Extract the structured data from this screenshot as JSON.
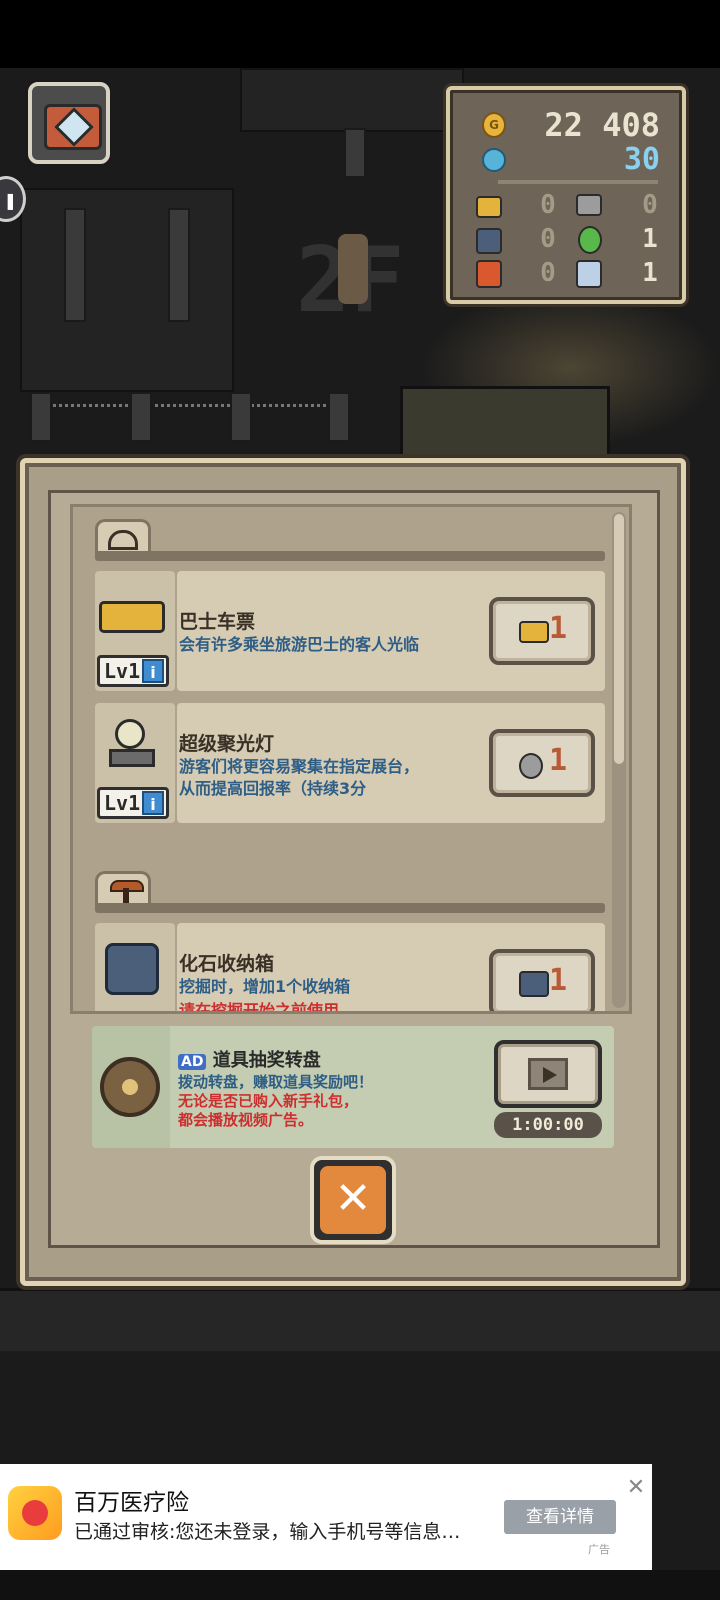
{
  "scene": {
    "floor_label": "2F"
  },
  "resources": {
    "coins": "22 408",
    "gems": "30",
    "inventory": [
      {
        "icon": "bus-ticket-icon",
        "count": "0",
        "color": "#e3b33c"
      },
      {
        "icon": "spotlight-icon",
        "count": "0",
        "color": "#9c9c9c"
      },
      {
        "icon": "storage-box-icon",
        "count": "0",
        "color": "#4c5f7a"
      },
      {
        "icon": "green-potion-icon",
        "count": "1",
        "color": "#58b84a"
      },
      {
        "icon": "red-canister-icon",
        "count": "0",
        "color": "#d9582e"
      },
      {
        "icon": "robot-icon",
        "count": "1",
        "color": "#bcd1e6"
      }
    ]
  },
  "shop": {
    "categories": [
      {
        "icon": "museum-icon"
      },
      {
        "icon": "pickaxe-icon"
      }
    ],
    "items": [
      {
        "title": "巴士车票",
        "desc1": "会有许多乘坐旅游巴士的客人光临",
        "desc2": "",
        "level": "Lv1",
        "qty": "1",
        "icon": "bus-icon"
      },
      {
        "title": "超级聚光灯",
        "desc1": "游客们将更容易聚集在指定展台，",
        "desc2": "从而提高回报率（持续3分",
        "level": "Lv1",
        "qty": "1",
        "icon": "spotlight-icon"
      },
      {
        "title": "化石收纳箱",
        "desc1": "挖掘时，增加1个收纳箱",
        "warning": "请在挖掘开始之前使用",
        "qty": "1",
        "icon": "storage-box-icon"
      }
    ],
    "ad_offer": {
      "badge": "AD",
      "title": "道具抽奖转盘",
      "line1": "拨动转盘，赚取道具奖励吧！",
      "line2": "无论是否已购入新手礼包，",
      "line3": "都会播放视频广告。",
      "timer": "1:00:00"
    },
    "close_symbol": "✕"
  },
  "banner_ad": {
    "title": "百万医疗险",
    "desc": "已通过审核:您还未登录，输入手机号等信息…",
    "cta": "查看详情",
    "close": "✕",
    "ad_label": "广告"
  },
  "colors": {
    "accent_orange": "#e2893e",
    "info_blue": "#2e5e86",
    "warning_red": "#cc2f2f"
  }
}
